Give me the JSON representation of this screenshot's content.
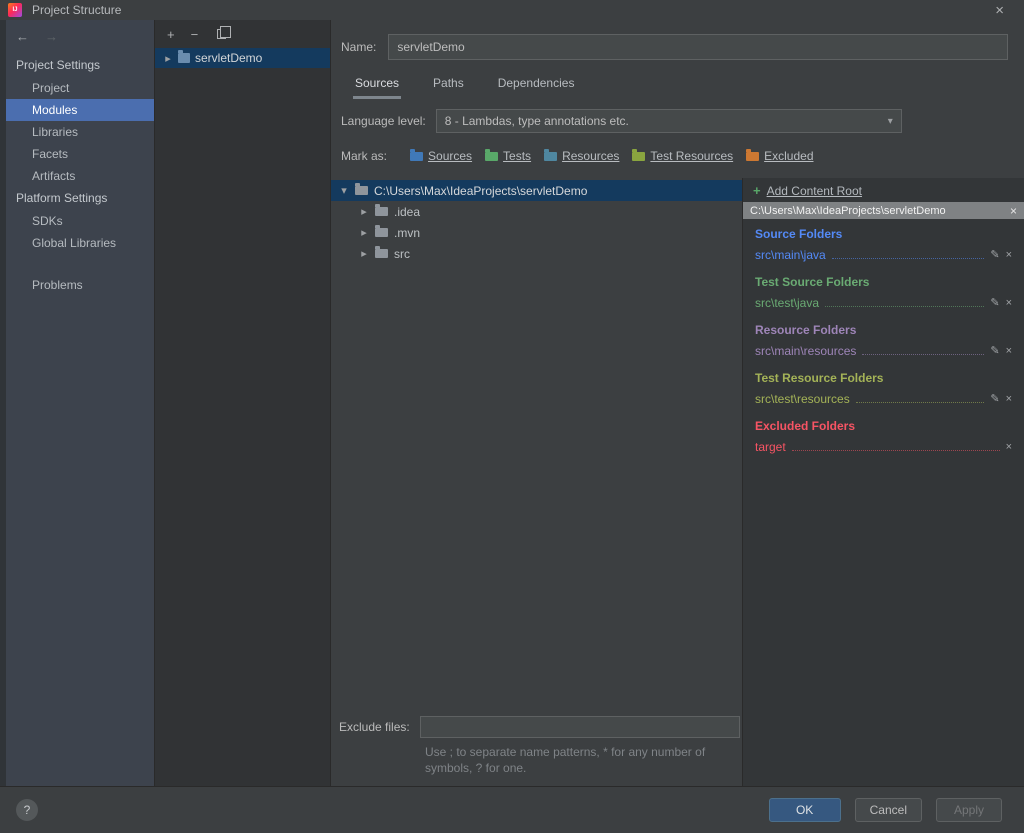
{
  "colors": {
    "selection-blue": "#4b6eaf",
    "tree-selection": "#143a5e",
    "ok-blue": "#365880"
  },
  "icons": {
    "close": "×",
    "back": "←",
    "forward": "→",
    "add": "+",
    "remove": "−",
    "chevron_right": "▸",
    "chevron_down": "▾",
    "dropdown_arrow": "▾",
    "edit": "✎",
    "delete": "×",
    "plus": "+",
    "help": "?"
  },
  "titlebar": {
    "logo_text": "IJ",
    "title": "Project Structure"
  },
  "sidebar": {
    "sections": [
      {
        "header": "Project Settings",
        "items": [
          {
            "label": "Project"
          },
          {
            "label": "Modules"
          },
          {
            "label": "Libraries"
          },
          {
            "label": "Facets"
          },
          {
            "label": "Artifacts"
          }
        ]
      },
      {
        "header": "Platform Settings",
        "items": [
          {
            "label": "SDKs"
          },
          {
            "label": "Global Libraries"
          }
        ]
      }
    ],
    "problems": "Problems"
  },
  "modules_panel": {
    "module_name": "servletDemo"
  },
  "module_editor": {
    "name_label": "Name:",
    "name_value": "servletDemo",
    "tabs": [
      {
        "label": "Sources"
      },
      {
        "label": "Paths"
      },
      {
        "label": "Dependencies"
      }
    ],
    "language_level_label": "Language level:",
    "language_level_value": "8 - Lambdas, type annotations etc.",
    "mark_as_label": "Mark as:",
    "mark_buttons": [
      {
        "label": "Sources",
        "folder_color": "#4079b8"
      },
      {
        "label": "Tests",
        "folder_color": "#59a869"
      },
      {
        "label": "Resources",
        "folder_color": "#4f87a0"
      },
      {
        "label": "Test Resources",
        "folder_color": "#8aa53f"
      },
      {
        "label": "Excluded",
        "folder_color": "#cc7832"
      }
    ],
    "tree": {
      "root": "C:\\Users\\Max\\IdeaProjects\\servletDemo",
      "children": [
        ".idea",
        ".mvn",
        "src"
      ]
    },
    "exclude_label": "Exclude files:",
    "exclude_value": "",
    "hint_line1": "Use ; to separate name patterns, * for any number of",
    "hint_line2": "symbols, ? for one."
  },
  "content_pane": {
    "add_content_root": "Add Content Root",
    "root_path": "C:\\Users\\Max\\IdeaProjects\\servletDemo",
    "groups": [
      {
        "title": "Source Folders",
        "color": "#548af7",
        "items": [
          "src\\main\\java"
        ]
      },
      {
        "title": "Test Source Folders",
        "color": "#6aab73",
        "items": [
          "src\\test\\java"
        ]
      },
      {
        "title": "Resource Folders",
        "color": "#9e85b8",
        "items": [
          "src\\main\\resources"
        ]
      },
      {
        "title": "Test Resource Folders",
        "color": "#a4b357",
        "items": [
          "src\\test\\resources"
        ]
      },
      {
        "title": "Excluded Folders",
        "color": "#f75464",
        "items": [
          "target"
        ]
      }
    ]
  },
  "footer": {
    "ok": "OK",
    "cancel": "Cancel",
    "apply": "Apply"
  }
}
